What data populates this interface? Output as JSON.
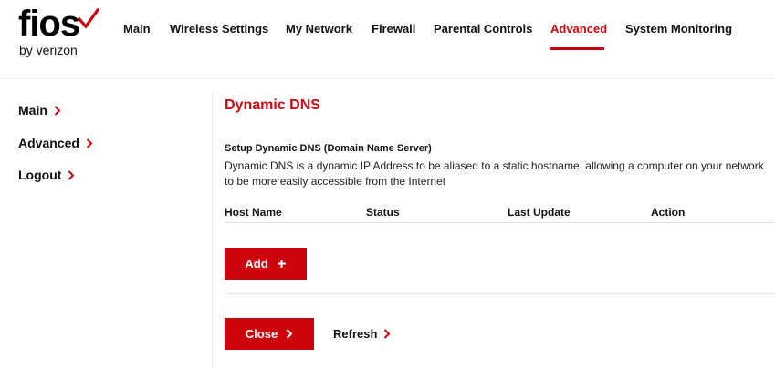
{
  "brand": {
    "name": "fios",
    "sub": "by verizon",
    "check_icon": "red-checkmark-icon",
    "accent_color": "#cd040b"
  },
  "nav": {
    "items": [
      {
        "label": "Main",
        "active": false
      },
      {
        "label": "Wireless Settings",
        "active": false
      },
      {
        "label": "My Network",
        "active": false
      },
      {
        "label": "Firewall",
        "active": false
      },
      {
        "label": "Parental Controls",
        "active": false
      },
      {
        "label": "Advanced",
        "active": true
      },
      {
        "label": "System Monitoring",
        "active": false
      }
    ]
  },
  "sidebar": {
    "items": [
      {
        "label": "Main",
        "icon": "chevron-right-icon"
      },
      {
        "label": "Advanced",
        "icon": "chevron-right-icon"
      },
      {
        "label": "Logout",
        "icon": "chevron-right-icon"
      }
    ]
  },
  "main": {
    "title": "Dynamic DNS",
    "subtitle": "Setup Dynamic DNS (Domain Name Server)",
    "description": "Dynamic DNS is a dynamic IP Address to be aliased to a static hostname, allowing a computer on your network to be more easily accessible from the Internet",
    "table": {
      "columns": [
        "Host Name",
        "Status",
        "Last Update",
        "Action"
      ],
      "rows": []
    },
    "add_label": "Add",
    "add_icon": "plus-icon",
    "close_label": "Close",
    "close_icon": "chevron-right-icon",
    "refresh_label": "Refresh",
    "refresh_icon": "chevron-right-icon"
  }
}
